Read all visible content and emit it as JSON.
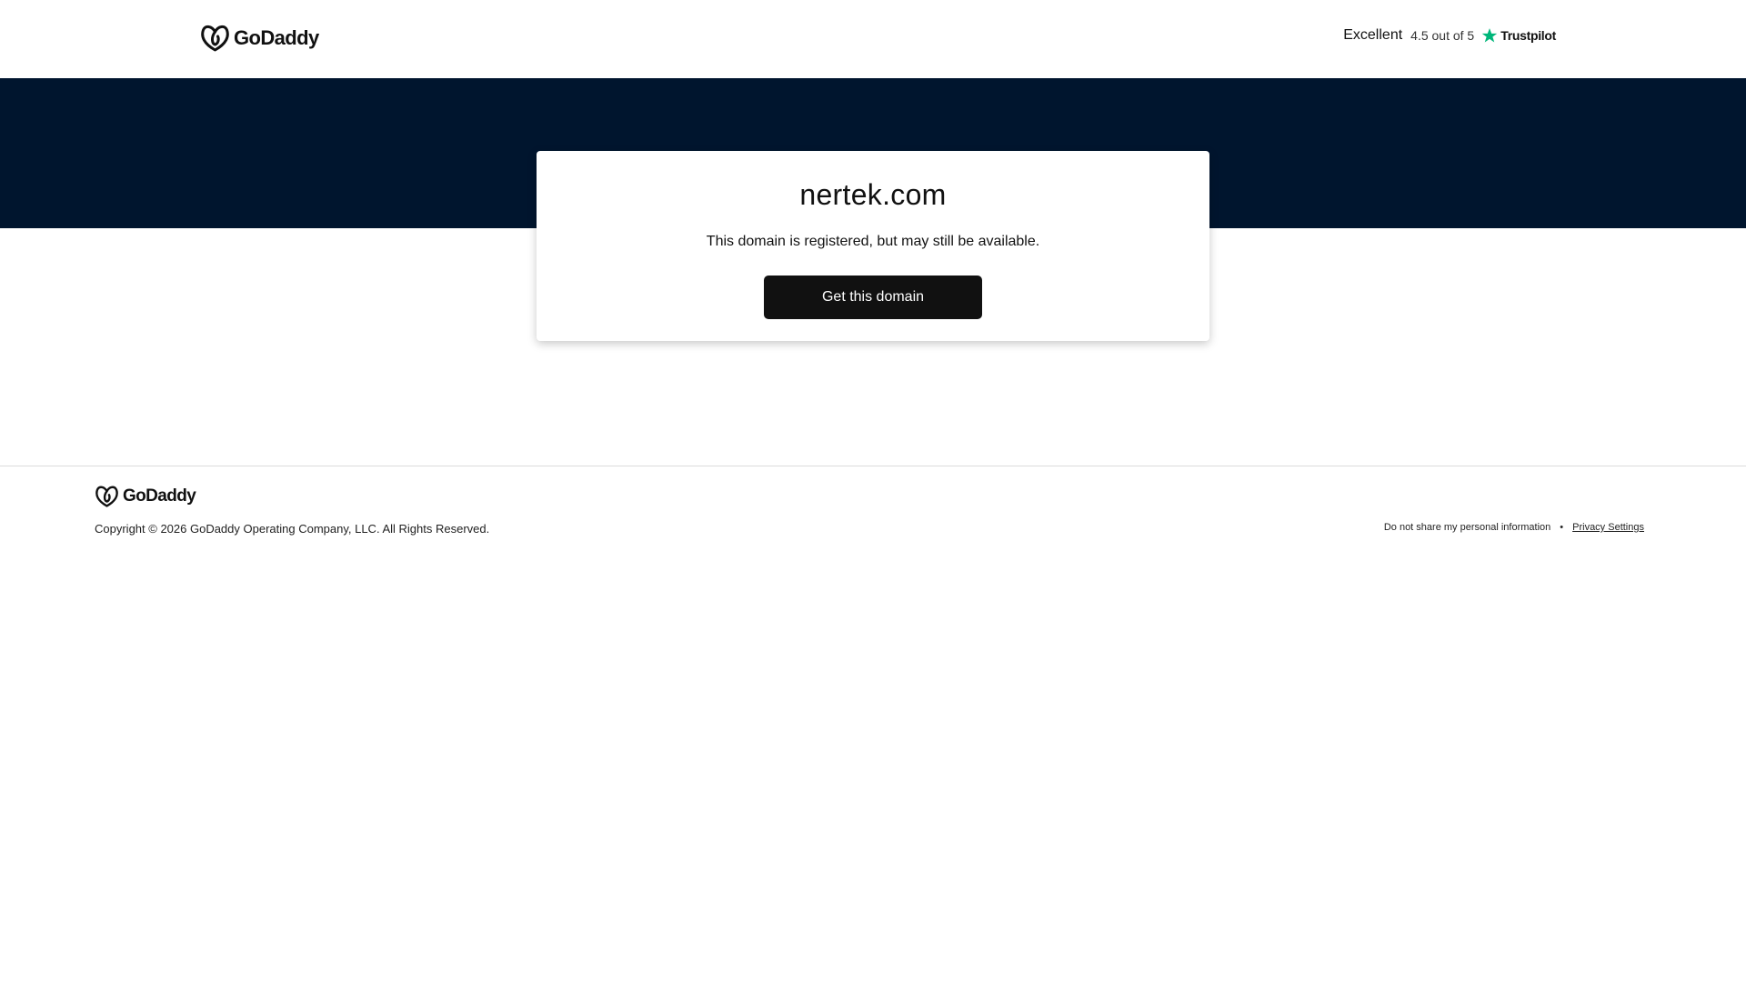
{
  "header": {
    "brand": "GoDaddy",
    "rating": {
      "label": "Excellent",
      "score_text": "4.5 out of 5",
      "provider": "Trustpilot",
      "star_color": "#00b67a"
    }
  },
  "hero": {
    "background_color": "#00152e"
  },
  "card": {
    "domain": "nertek.com",
    "status_text": "This domain is registered, but may still be available.",
    "cta_label": "Get this domain"
  },
  "footer": {
    "brand": "GoDaddy",
    "copyright": "Copyright © 2026 GoDaddy Operating Company, LLC. All Rights Reserved.",
    "links": {
      "do_not_share": "Do not share my personal information",
      "separator": "•",
      "privacy_settings": "Privacy Settings"
    }
  }
}
